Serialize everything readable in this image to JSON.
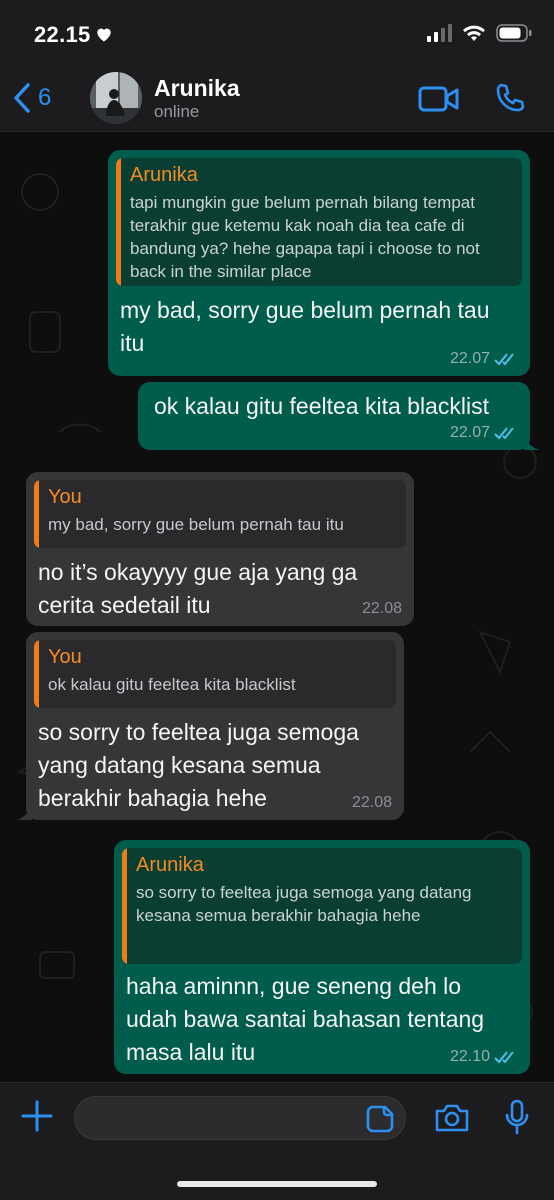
{
  "status_bar": {
    "time": "22.15"
  },
  "header": {
    "back_count": "6",
    "contact_name": "Arunika",
    "contact_status": "online"
  },
  "messages": [
    {
      "direction": "outgoing",
      "quote_author": "Arunika",
      "quote_text": "tapi mungkin gue belum pernah bilang tempat terakhir gue ketemu kak noah dia tea cafe di bandung ya? hehe gapapa tapi i choose to not back in the similar place",
      "text": "my bad, sorry gue belum pernah tau itu",
      "time": "22.07",
      "read": true
    },
    {
      "direction": "outgoing",
      "text": "ok kalau gitu feeltea kita blacklist",
      "time": "22.07",
      "read": true
    },
    {
      "direction": "incoming",
      "quote_author": "You",
      "quote_text": "my bad, sorry gue belum pernah tau itu",
      "text": "no it’s okayyyy gue aja yang ga cerita sedetail itu",
      "time": "22.08"
    },
    {
      "direction": "incoming",
      "quote_author": "You",
      "quote_text": "ok kalau gitu feeltea kita blacklist",
      "text": "so sorry to feeltea juga semoga yang datang kesana semua berakhir bahagia hehe",
      "time": "22.08"
    },
    {
      "direction": "outgoing",
      "quote_author": "Arunika",
      "quote_text": "so sorry to feeltea juga semoga yang datang kesana semua berakhir bahagia hehe",
      "text": "haha aminnn, gue seneng deh lo udah bawa santai bahasan tentang masa lalu itu",
      "time": "22.10",
      "read": true
    }
  ],
  "composer": {
    "placeholder": ""
  },
  "colors": {
    "accent": "#2f8ff0",
    "outgoing_bubble": "#005c4b",
    "incoming_bubble": "#363638",
    "quote_author": "#f58a23",
    "read_ticks": "#53bdeb"
  },
  "icons": [
    "heart-icon",
    "signal-icon",
    "wifi-icon",
    "battery-icon",
    "back-chevron-icon",
    "video-call-icon",
    "phone-call-icon",
    "plus-icon",
    "sticker-icon",
    "camera-icon",
    "microphone-icon",
    "read-ticks-icon"
  ]
}
